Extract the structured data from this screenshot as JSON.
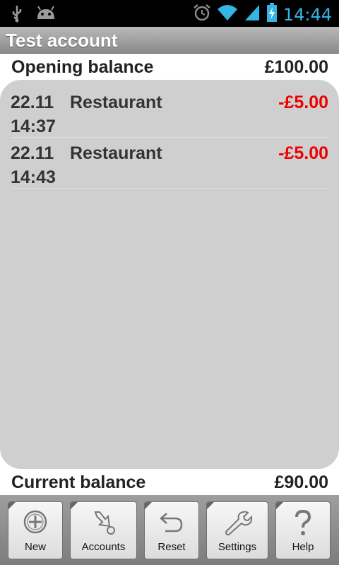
{
  "status_bar": {
    "time": "14:44",
    "icons_left": [
      "usb-icon",
      "android-icon"
    ],
    "icons_right": [
      "alarm-icon",
      "wifi-icon",
      "signal-icon",
      "battery-charging-icon"
    ],
    "accent_color": "#33b5e5"
  },
  "header": {
    "title": "Test account"
  },
  "opening_balance": {
    "label": "Opening balance",
    "value": "£100.00"
  },
  "transactions": [
    {
      "date": "22.11",
      "time": "14:37",
      "description": "Restaurant",
      "amount": "-£5.00"
    },
    {
      "date": "22.11",
      "time": "14:43",
      "description": "Restaurant",
      "amount": "-£5.00"
    }
  ],
  "current_balance": {
    "label": "Current balance",
    "value": "£90.00"
  },
  "toolbar": {
    "new_label": "New",
    "accounts_label": "Accounts",
    "reset_label": "Reset",
    "settings_label": "Settings",
    "help_label": "Help"
  },
  "colors": {
    "negative_amount": "#ee0000",
    "panel_bg": "#cfcfcf"
  }
}
